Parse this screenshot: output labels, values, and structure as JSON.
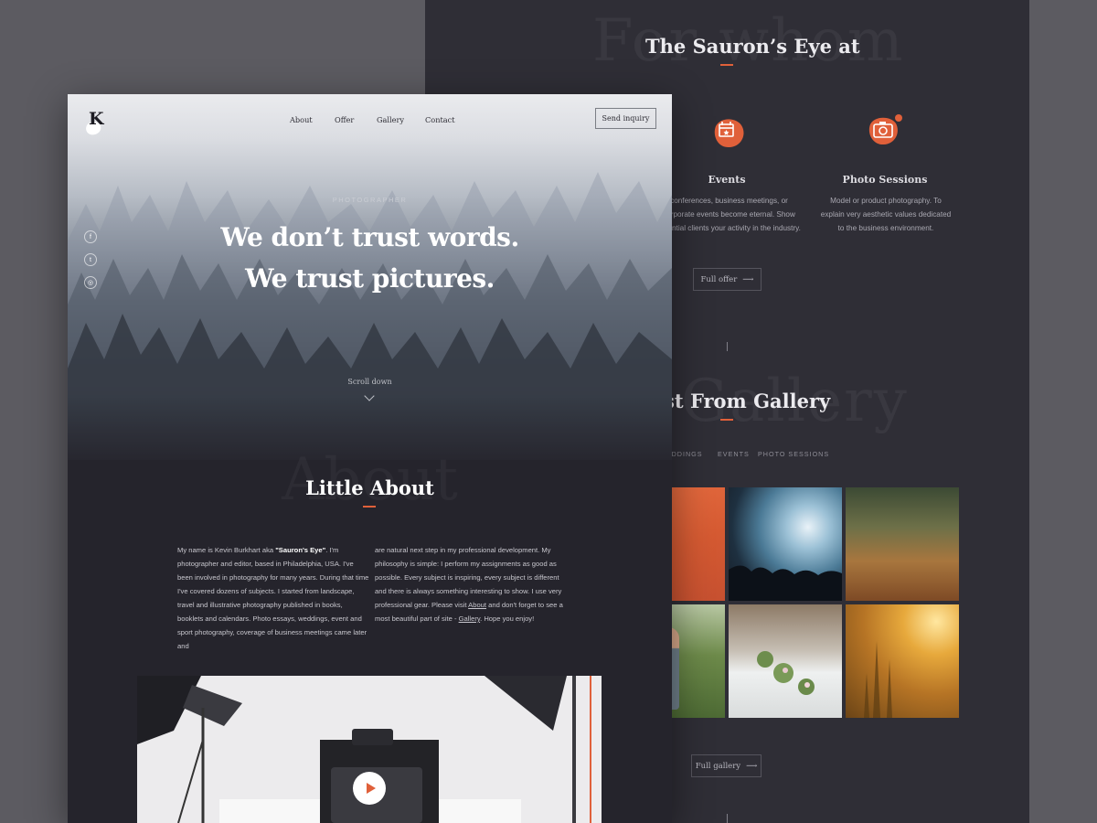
{
  "back_page": {
    "offer": {
      "ghost_text": "For whom",
      "title": "The Sauron’s Eye at",
      "services": [
        {
          "title": "Events",
          "icon": "calendar-icon",
          "text": "conferences, business meetings, or corporate events become eternal. Show potential clients your activity in the industry."
        },
        {
          "title": "Photo Sessions",
          "icon": "camera-icon",
          "text": "Model or product photography. To explain very aesthetic values dedicated to the business environment."
        }
      ],
      "button_label": "Full offer",
      "button_icon": "arrow-right-icon"
    },
    "gallery": {
      "ghost_text": "Gallery",
      "title": "Best From Gallery",
      "filters": [
        "WEDDINGS",
        "EVENTS",
        "PHOTO SESSIONS"
      ],
      "images": [
        "orange-abstract",
        "concert-crowd",
        "autumn-leaves",
        "child-outdoors",
        "wedding-table",
        "golden-field"
      ],
      "button_label": "Full gallery",
      "button_icon": "arrow-right-icon"
    }
  },
  "front_page": {
    "logo": "K",
    "nav": [
      {
        "label": "About"
      },
      {
        "label": "Offer"
      },
      {
        "label": "Gallery"
      },
      {
        "label": "Contact"
      }
    ],
    "inquiry_button": "Send inquiry",
    "social": [
      {
        "icon": "facebook-icon",
        "glyph": "f"
      },
      {
        "icon": "twitter-icon",
        "glyph": "t"
      },
      {
        "icon": "instagram-icon",
        "glyph": "◎"
      }
    ],
    "hero": {
      "eyebrow": "PHOTOGRAPHER",
      "line1": "We don’t trust words.",
      "line2": "We trust pictures.",
      "scroll_label": "Scroll down"
    },
    "about": {
      "ghost_text": "About",
      "title": "Little About",
      "col1_pre": "My name is Kevin Burkhart aka ",
      "col1_bold": "\"Sauron's Eye\"",
      "col1_post": ". I'm photographer and editor, based in Philadelphia, USA. I've been involved in photography for many years. During that time I've covered dozens of subjects. I started from landscape, travel and illustrative photography published in books, booklets and calendars. Photo essays, weddings, event and sport photography, coverage of business meetings came later and",
      "col2_pre": "are natural next step in my professional development. My philosophy is simple: I perform my assignments as good as possible. Every subject is inspiring, every subject is different and there is always something interesting to show. I use very professional gear. Please visit ",
      "col2_link1": "About",
      "col2_mid": " and don't forget to see a most beautiful part of site - ",
      "col2_link2": "Gallery",
      "col2_post": ". Hope you enjoy!"
    },
    "video": {
      "play_icon": "play-icon"
    }
  },
  "colors": {
    "accent": "#e0603a",
    "background": "#5c5b61",
    "dark_panel": "#2f2e36",
    "front_panel": "#25242c"
  }
}
